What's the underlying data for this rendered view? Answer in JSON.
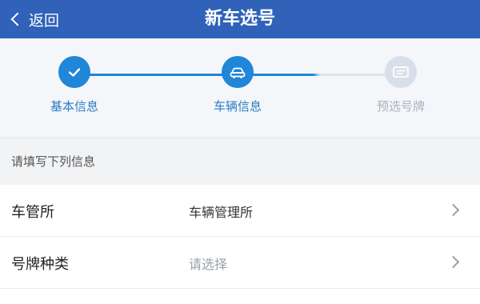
{
  "navbar": {
    "back_label": "返回",
    "title": "新车选号",
    "bg_color": "#2f62b8"
  },
  "steps": [
    {
      "label": "基本信息",
      "icon": "check-icon",
      "state": "done"
    },
    {
      "label": "车辆信息",
      "icon": "car-icon",
      "state": "current"
    },
    {
      "label": "预选号牌",
      "icon": "plate-icon",
      "state": "pending"
    }
  ],
  "colors": {
    "step_active": "#1f86d8",
    "step_inactive": "#c7d3e0",
    "label_active": "#2b7cc4",
    "label_inactive": "#aab3bd",
    "value_filled": "#333333",
    "value_placeholder": "#9aa0a6"
  },
  "form": {
    "hint": "请填写下列信息",
    "fields": [
      {
        "label": "车管所",
        "value": "车辆管理所",
        "filled": true
      },
      {
        "label": "号牌种类",
        "value": "请选择",
        "filled": false
      }
    ]
  }
}
